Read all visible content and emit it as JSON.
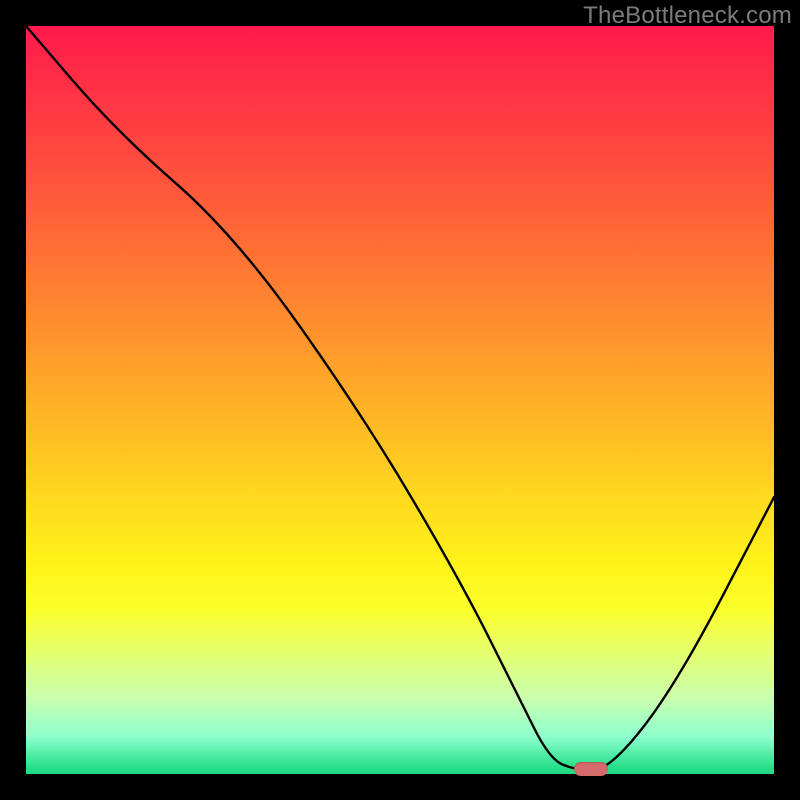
{
  "watermark": "TheBottleneck.com",
  "chart_data": {
    "type": "line",
    "title": "",
    "xlabel": "",
    "ylabel": "",
    "xlim": [
      0,
      100
    ],
    "ylim": [
      0,
      100
    ],
    "grid": false,
    "series": [
      {
        "name": "curve",
        "x": [
          0,
          12,
          28,
          45,
          58,
          66,
          70,
          73.5,
          78,
          87,
          100
        ],
        "values": [
          100,
          86,
          72,
          48,
          26,
          10,
          2,
          0.5,
          0.5,
          12,
          37
        ]
      }
    ],
    "marker": {
      "x": 75.5,
      "y": 0.7
    },
    "background_gradient": {
      "top": "#ff1a4d",
      "mid": "#ffd91f",
      "bottom": "#1fd884"
    }
  }
}
